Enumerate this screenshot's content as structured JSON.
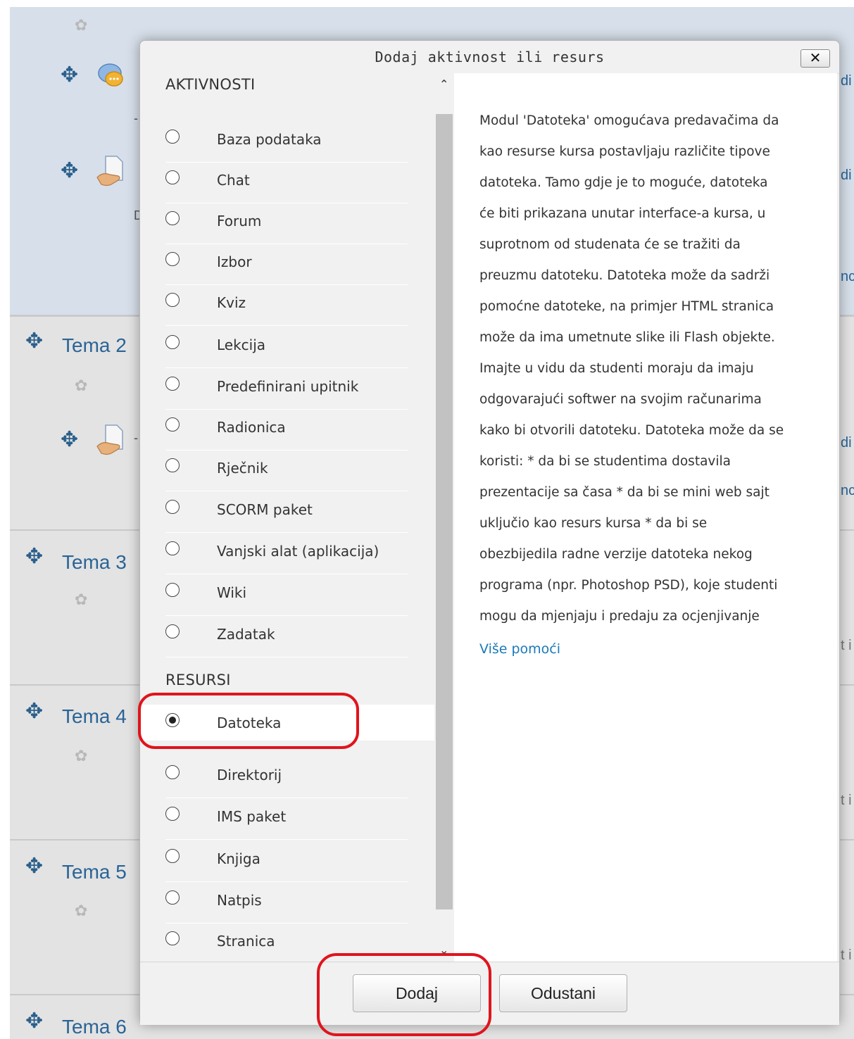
{
  "background": {
    "sections": [
      {
        "title": "Tema 2"
      },
      {
        "title": "Tema 3"
      },
      {
        "title": "Tema 4"
      },
      {
        "title": "Tema 5"
      },
      {
        "title": "Tema 6"
      }
    ],
    "edge_fragments": [
      "di",
      "di",
      "nc",
      "di",
      "nc",
      "t i",
      "t i",
      "t i"
    ],
    "small_fragments": [
      "-",
      "D",
      "-"
    ]
  },
  "dialog": {
    "title": "Dodaj aktivnost ili resurs",
    "close_label": "✕",
    "activities_header": "AKTIVNOSTI",
    "activities": [
      "Baza podataka",
      "Chat",
      "Forum",
      "Izbor",
      "Kviz",
      "Lekcija",
      "Predefinirani upitnik",
      "Radionica",
      "Rječnik",
      "SCORM paket",
      "Vanjski alat (aplikacija)",
      "Wiki",
      "Zadatak"
    ],
    "resources_header": "RESURSI",
    "resources": [
      "Datoteka",
      "Direktorij",
      "IMS paket",
      "Knjiga",
      "Natpis",
      "Stranica"
    ],
    "selected": "Datoteka",
    "description_lines": [
      "Modul 'Datoteka' omogućava predavačima da",
      "kao resurse kursa postavljaju različite tipove",
      "datoteka. Tamo gdje je to moguće, datoteka",
      "će biti prikazana unutar interface-a kursa, u",
      "suprotnom od studenata će se tražiti da",
      "preuzmu datoteku. Datoteka može da sadrži",
      "pomoćne datoteke, na primjer HTML stranica",
      "može da ima umetnute slike ili Flash objekte.",
      "Imajte u vidu da studenti moraju da imaju",
      "odgovarajući softwer na svojim računarima",
      "kako bi otvorili datoteku. Datoteka može da se",
      "koristi: * da bi se studentima dostavila",
      "prezentacije sa časa * da bi se mini web sajt",
      "uključio kao resurs kursa * da bi se",
      "obezbijedila radne verzije datoteka nekog",
      "programa (npr. Photoshop PSD), koje studenti",
      "mogu da mjenjaju i predaju za ocjenjivanje"
    ],
    "more_help": "Više pomoći",
    "add_button": "Dodaj",
    "cancel_button": "Odustani"
  },
  "colors": {
    "accent": "#2a6496",
    "link": "#1a7ab8",
    "annotation": "#e0141c"
  }
}
